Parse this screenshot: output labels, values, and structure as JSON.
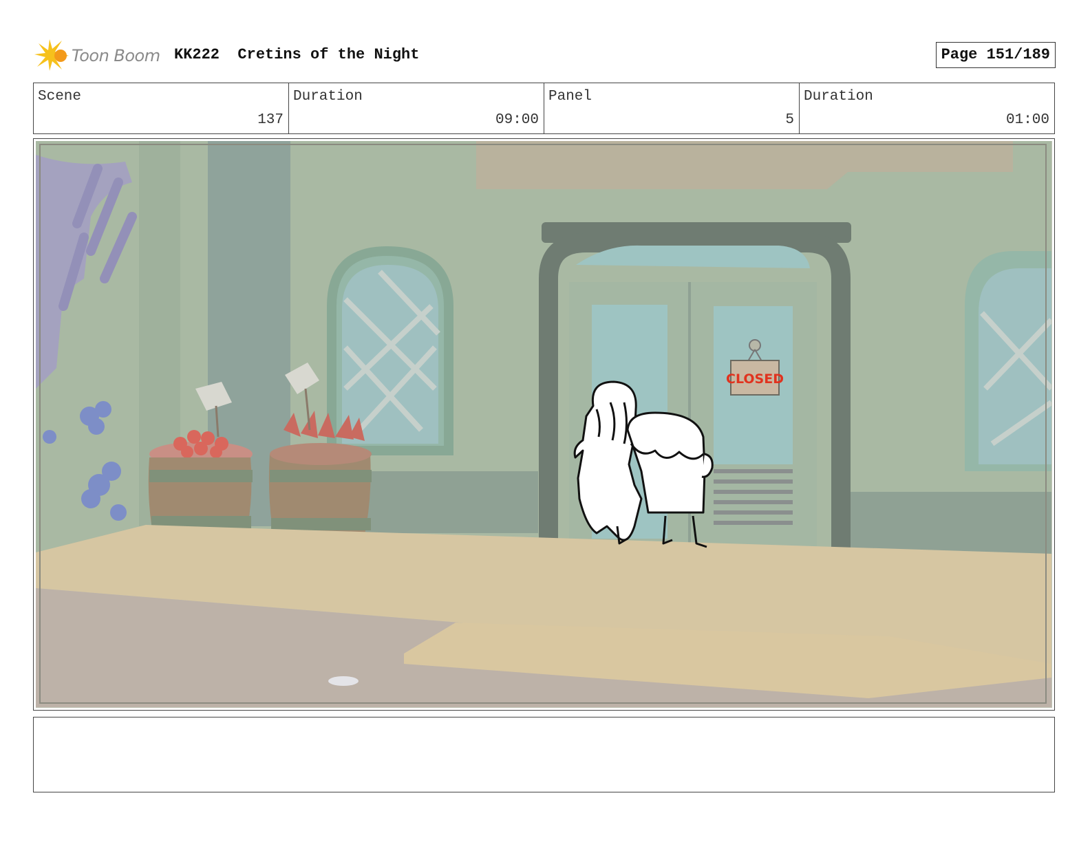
{
  "header": {
    "logo_text": "Toon Boom",
    "title": "KK222  Cretins of the Night",
    "page": "Page 151/189"
  },
  "info": {
    "scene_label": "Scene",
    "scene_value": "137",
    "duration_label": "Duration",
    "duration_value": "09:00",
    "panel_label": "Panel",
    "panel_value": "5",
    "panel_duration_label": "Duration",
    "panel_duration_value": "01:00"
  },
  "panel": {
    "sign_text": "CLOSED"
  },
  "notes": {
    "text": ""
  }
}
